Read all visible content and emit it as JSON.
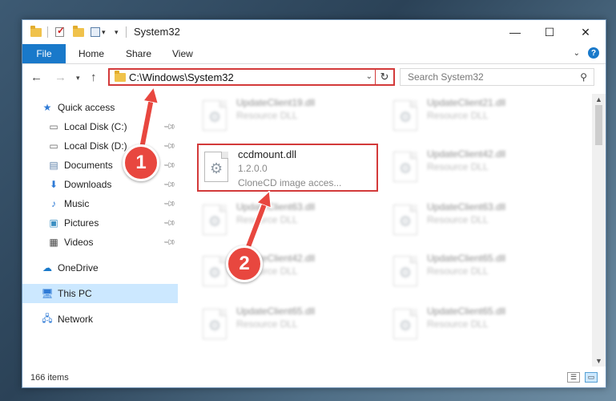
{
  "window": {
    "title": "System32",
    "controls": {
      "minimize": "—",
      "maximize": "☐",
      "close": "✕"
    }
  },
  "ribbon": {
    "file": "File",
    "tabs": [
      "Home",
      "Share",
      "View"
    ],
    "help": "?"
  },
  "address": {
    "path": "C:\\Windows\\System32",
    "search_placeholder": "Search System32"
  },
  "sidebar": {
    "items": [
      {
        "label": "Quick access",
        "icon": "star-icon"
      },
      {
        "label": "Local Disk (C:)",
        "icon": "drive-icon",
        "pinned": true
      },
      {
        "label": "Local Disk (D:)",
        "icon": "drive-icon",
        "pinned": true
      },
      {
        "label": "Documents",
        "icon": "documents-icon",
        "pinned": true
      },
      {
        "label": "Downloads",
        "icon": "downloads-icon",
        "pinned": true
      },
      {
        "label": "Music",
        "icon": "music-icon",
        "pinned": true
      },
      {
        "label": "Pictures",
        "icon": "pictures-icon",
        "pinned": true
      },
      {
        "label": "Videos",
        "icon": "videos-icon",
        "pinned": true
      },
      {
        "label": "OneDrive",
        "icon": "cloud-icon"
      },
      {
        "label": "This PC",
        "icon": "computer-icon",
        "selected": true
      },
      {
        "label": "Network",
        "icon": "network-icon"
      }
    ]
  },
  "files": {
    "focused": {
      "name": "ccdmount.dll",
      "version": "1.2.0.0",
      "description": "CloneCD image acces..."
    },
    "blurred": [
      {
        "name": "UpdateClient19.dll",
        "type": "Resource DLL"
      },
      {
        "name": "UpdateClient21.dll",
        "type": "Resource DLL"
      },
      {
        "name": "UpdateClient42.dll",
        "type": "Resource DLL"
      },
      {
        "name": "UpdateClient63.dll",
        "type": "Resource DLL"
      },
      {
        "name": "UpdateClient63.dll",
        "type": "Resource DLL"
      },
      {
        "name": "UpdateClient42.dll",
        "type": "Resource DLL"
      },
      {
        "name": "UpdateClient65.dll",
        "type": "Resource DLL"
      },
      {
        "name": "UpdateClient65.dll",
        "type": "Resource DLL"
      },
      {
        "name": "UpdateClient65.dll",
        "type": "Resource DLL"
      }
    ]
  },
  "status": {
    "count": "166 items"
  },
  "annotations": {
    "step1": "1",
    "step2": "2",
    "color": "#e8473f",
    "box_color": "#d33a3a"
  }
}
